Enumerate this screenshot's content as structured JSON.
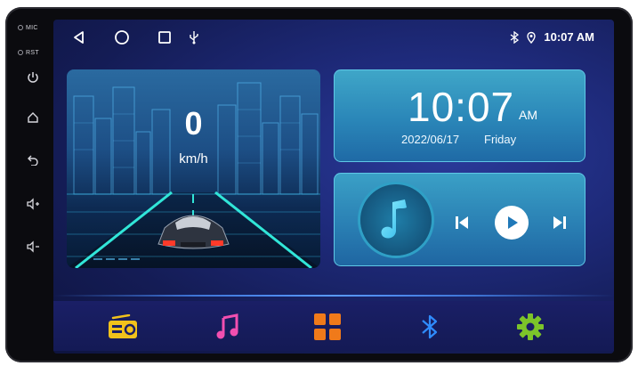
{
  "hardware": {
    "mic_label": "MIC",
    "rst_label": "RST",
    "buttons": [
      {
        "name": "power-button",
        "icon": "power-icon"
      },
      {
        "name": "home-button",
        "icon": "home-icon"
      },
      {
        "name": "back-button",
        "icon": "back-icon"
      },
      {
        "name": "volume-up-button",
        "icon": "volume-up-icon"
      },
      {
        "name": "volume-down-button",
        "icon": "volume-down-icon"
      }
    ]
  },
  "statusbar": {
    "nav_icons": [
      "back-triangle-icon",
      "home-circle-icon",
      "recents-square-icon",
      "usb-icon"
    ],
    "bluetooth_icon": "bluetooth-icon",
    "location_icon": "location-icon",
    "time": "10:07 AM"
  },
  "speed_card": {
    "value": "0",
    "unit": "km/h"
  },
  "clock_card": {
    "time": "10:07",
    "ampm": "AM",
    "date": "2022/06/17",
    "day": "Friday"
  },
  "music_card": {
    "note_icon": "music-note-icon",
    "controls": [
      "previous-icon",
      "play-icon",
      "next-icon"
    ]
  },
  "dock": {
    "items": [
      {
        "name": "radio",
        "icon": "radio-icon",
        "color": "#f2c21b"
      },
      {
        "name": "music",
        "icon": "music-icon",
        "color": "#f24fb0"
      },
      {
        "name": "apps",
        "icon": "apps-grid-icon",
        "color": "#f07a1a"
      },
      {
        "name": "bluetooth",
        "icon": "bluetooth-icon",
        "color": "#2f8cff"
      },
      {
        "name": "settings",
        "icon": "settings-gear-icon",
        "color": "#7cc42a"
      }
    ]
  },
  "colors": {
    "screen_bg": "#1e2a7a",
    "card_accent": "#5fc8e6"
  }
}
